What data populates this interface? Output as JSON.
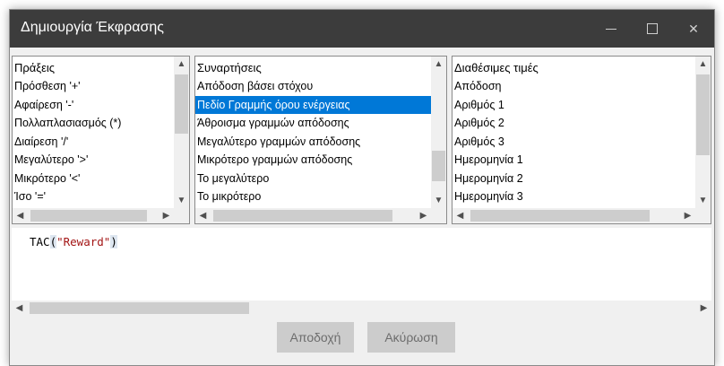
{
  "window": {
    "title": "Δημιουργία Έκφρασης"
  },
  "lists": {
    "operations": {
      "header": "Πράξεις",
      "items": [
        "Πρόσθεση '+'",
        "Αφαίρεση '-'",
        "Πολλαπλασιασμός (*)",
        "Διαίρεση '/'",
        "Μεγαλύτερο '>'",
        "Μικρότερο '<'",
        "Ίσο '='"
      ]
    },
    "functions": {
      "header": "Συναρτήσεις",
      "items": [
        "Απόδοση βάσει στόχου",
        "Πεδίο Γραμμής όρου ενέργειας",
        "Άθροισμα γραμμών απόδοσης",
        "Μεγαλύτερο γραμμών απόδοσης",
        "Μικρότερο γραμμών απόδοσης",
        "Το μεγαλύτερο",
        "Το μικρότερο"
      ],
      "selected": "Πεδίο Γραμμής όρου ενέργειας"
    },
    "values": {
      "header": "Διαθέσιμες τιμές",
      "items": [
        "Απόδοση",
        "Αριθμός 1",
        "Αριθμός 2",
        "Αριθμός 3",
        "Ημερομηνία 1",
        "Ημερομηνία 2",
        "Ημερομηνία 3"
      ]
    }
  },
  "editor": {
    "fn": "TAC",
    "open": "(",
    "arg": "\"Reward\"",
    "close": ")"
  },
  "buttons": {
    "accept": "Αποδοχή",
    "cancel": "Ακύρωση"
  },
  "icons": {
    "up": "▲",
    "down": "▼",
    "left": "◀",
    "right": "▶",
    "close": "✕"
  },
  "colors": {
    "titlebar": "#3c3c3c",
    "selection": "#0078d7",
    "string": "#a31515"
  }
}
